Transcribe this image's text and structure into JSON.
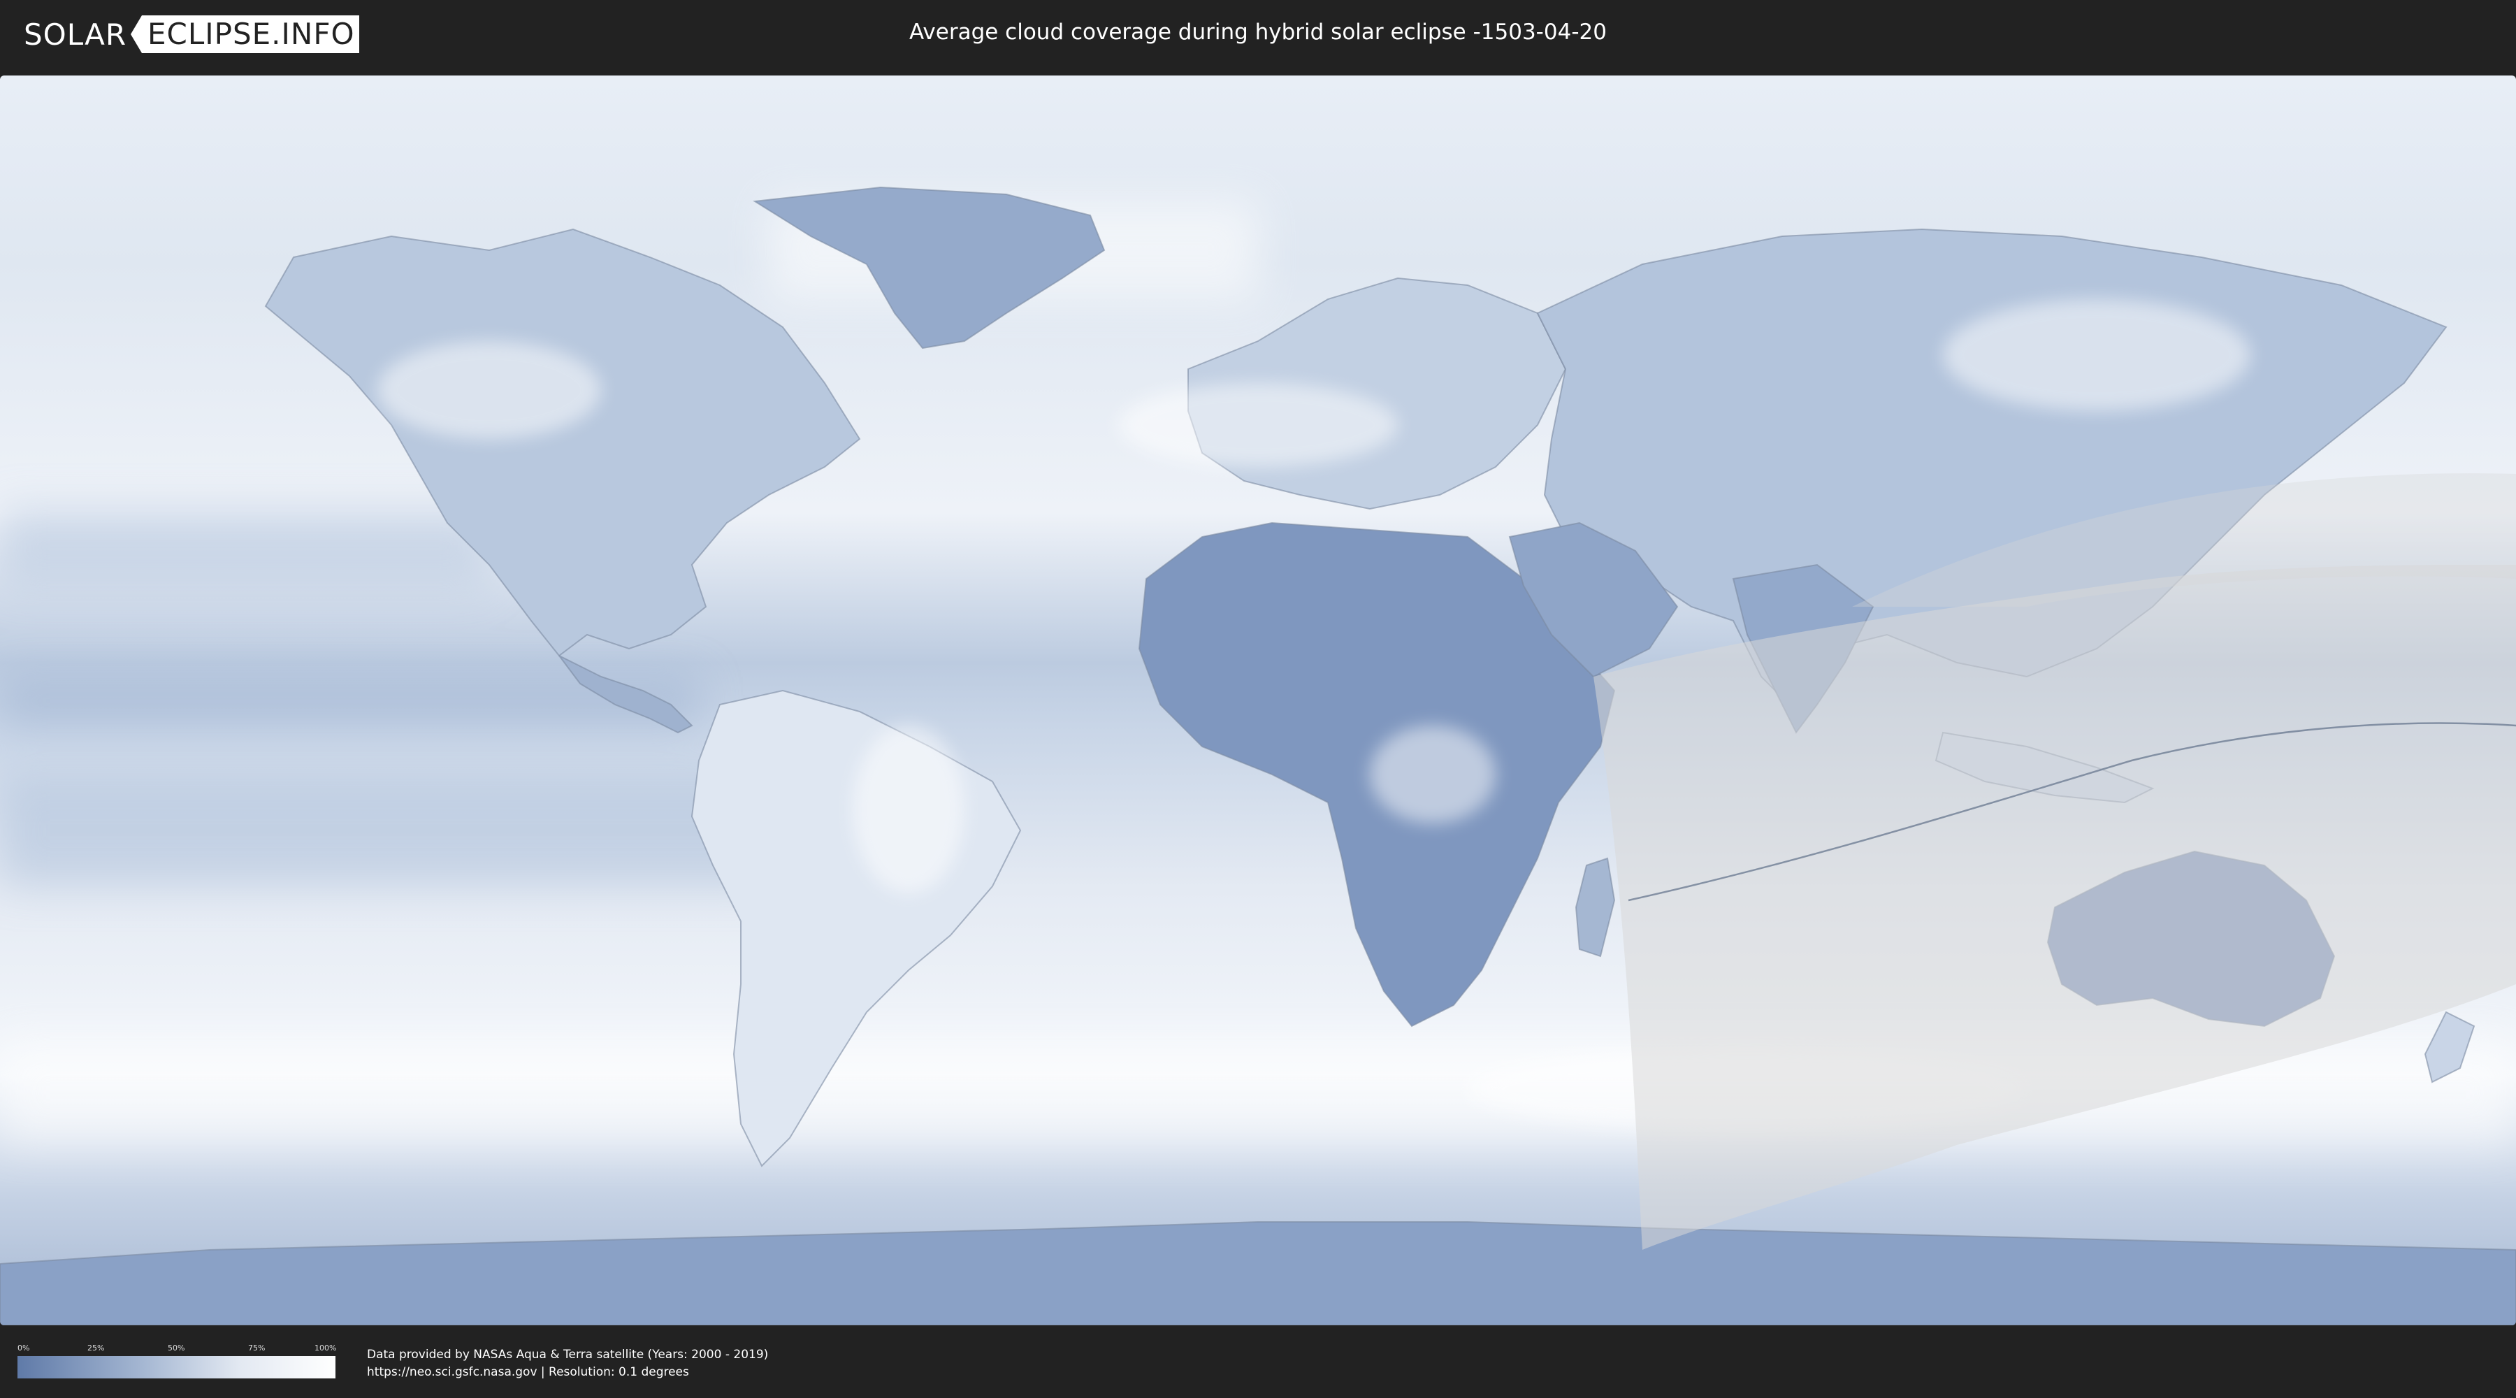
{
  "header": {
    "logo_left": "SOLAR",
    "logo_right": "ECLIPSE.INFO",
    "title": "Average cloud coverage during hybrid solar eclipse -1503-04-20"
  },
  "legend": {
    "ticks": [
      "0%",
      "25%",
      "50%",
      "75%",
      "100%"
    ],
    "colors": [
      "#5f7aa8",
      "#a6b8d3",
      "#e3e9f2",
      "#ffffff"
    ]
  },
  "credits": {
    "line1": "Data provided by NASAs Aqua & Terra satellite (Years: 2000 - 2019)",
    "line2": "https://neo.sci.gsfc.nasa.gov | Resolution: 0.1 degrees"
  },
  "map": {
    "projection": "equirectangular",
    "colors": {
      "clear": "#5f7aa8",
      "cloudy": "#ffffff",
      "ocean_mid": "#c9d6e8",
      "eclipse_zone": "#d8d8d8",
      "border": "#6e7d94"
    },
    "eclipse_zone_visible": true,
    "central_line_visible": true
  }
}
